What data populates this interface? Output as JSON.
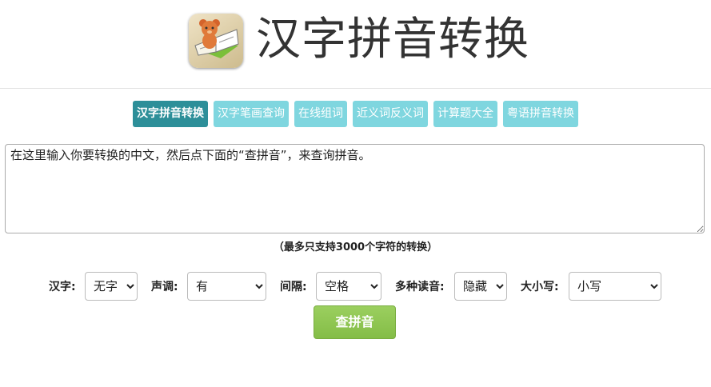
{
  "header": {
    "title": "汉字拼音转换",
    "logo_icon": "teddy-bear-book-icon"
  },
  "tabs": [
    {
      "label": "汉字拼音转换",
      "active": true
    },
    {
      "label": "汉字笔画查询",
      "active": false
    },
    {
      "label": "在线组词",
      "active": false
    },
    {
      "label": "近义词反义词",
      "active": false
    },
    {
      "label": "计算题大全",
      "active": false
    },
    {
      "label": "粤语拼音转换",
      "active": false
    }
  ],
  "input": {
    "placeholder": "在这里输入你要转换的中文，然后点下面的“查拼音”，来查询拼音。",
    "value": ""
  },
  "limit_note": "（最多只支持3000个字符的转换）",
  "options": {
    "hanzi": {
      "label": "汉字:",
      "selected": "无字"
    },
    "tone": {
      "label": "声调:",
      "selected": "有"
    },
    "spacing": {
      "label": "间隔:",
      "selected": "空格"
    },
    "multi": {
      "label": "多种读音:",
      "selected": "隐藏"
    },
    "case": {
      "label": "大小写:",
      "selected": "小写"
    }
  },
  "submit": {
    "label": "查拼音"
  },
  "colors": {
    "tab_active": "#2d8f99",
    "tab_inactive": "#7fd6df",
    "button": "#8cc34e"
  }
}
